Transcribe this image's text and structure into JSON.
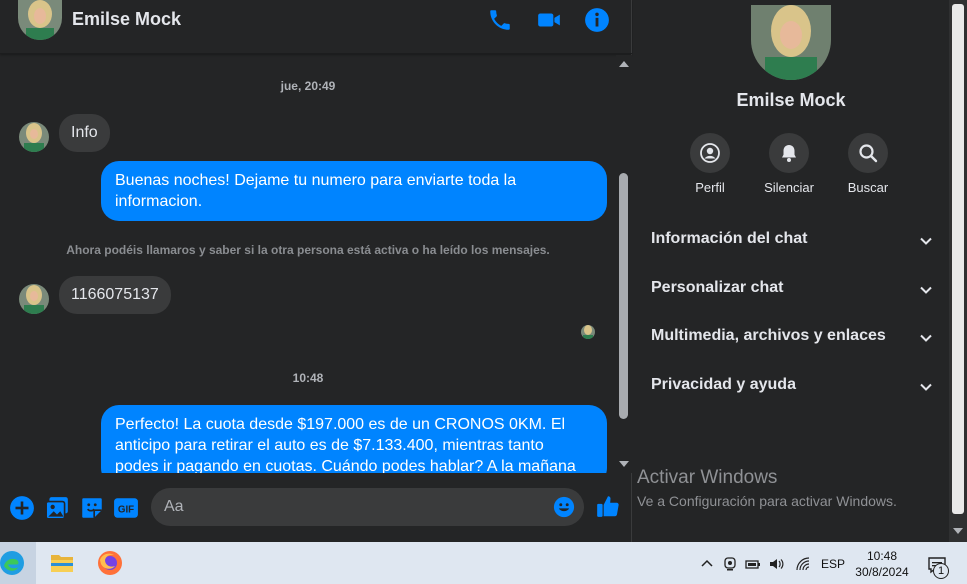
{
  "header": {
    "contact_name": "Emilse Mock"
  },
  "messages": {
    "time_1": "jue, 20:49",
    "in_1": "Info",
    "out_1_line1": "Buenas noches! Dejame tu numero para enviarte toda la",
    "out_1_line2": "informacion.",
    "notice": "Ahora podéis llamaros y saber si la otra persona está activa o ha leído los mensajes.",
    "in_2": "1166075137",
    "time_2": "10:48",
    "out_2_line1": "Perfecto! La cuota desde $197.000 es de un CRONOS 0KM. El",
    "out_2_line2": "anticipo para retirar el auto es de $7.133.400, mientras tanto",
    "out_2_line3": "podes ir pagando en cuotas. Cuándo podes hablar? A la mañana"
  },
  "composer": {
    "placeholder": "Aa"
  },
  "info_panel": {
    "name": "Emilse Mock",
    "actions": [
      "Perfil",
      "Silenciar",
      "Buscar"
    ],
    "sections": [
      "Información del chat",
      "Personalizar chat",
      "Multimedia, archivos y enlaces",
      "Privacidad y ayuda"
    ]
  },
  "watermark": {
    "title": "Activar Windows",
    "subtitle": "Ve a Configuración para activar Windows."
  },
  "taskbar": {
    "language": "ESP",
    "time": "10:48",
    "date": "30/8/2024",
    "notification_count": "1"
  },
  "colors": {
    "accent": "#0084ff",
    "background": "#242526",
    "bubble_in": "#3a3b3c"
  }
}
